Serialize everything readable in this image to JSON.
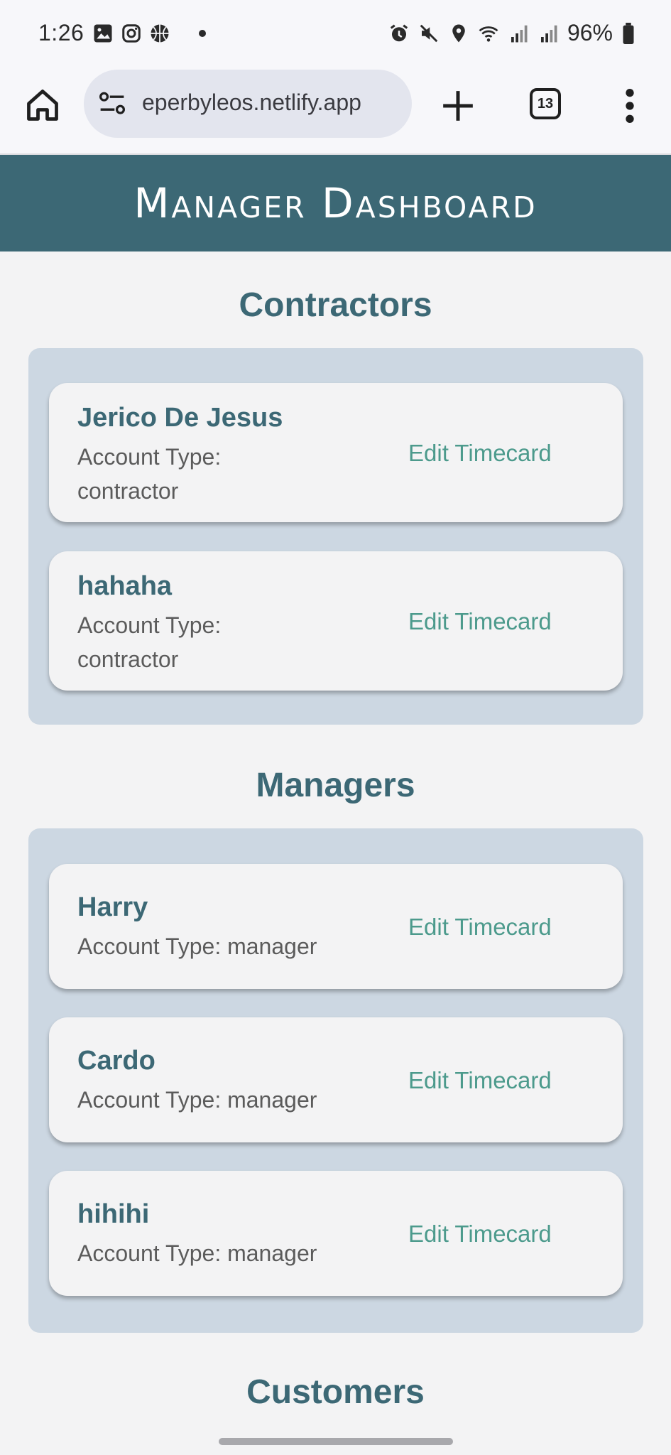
{
  "status_bar": {
    "time": "1:26",
    "battery": "96%"
  },
  "browser": {
    "url": "eperbyleos.netlify.app",
    "tab_count": "13"
  },
  "app": {
    "title": "Manager Dashboard"
  },
  "sections": {
    "contractors": {
      "title": "Contractors",
      "items": [
        {
          "name": "Jerico De Jesus",
          "account_type_line1": "Account Type:",
          "account_type_line2": "contractor",
          "action": "Edit Timecard"
        },
        {
          "name": "hahaha",
          "account_type_line1": "Account Type:",
          "account_type_line2": "contractor",
          "action": "Edit Timecard"
        }
      ]
    },
    "managers": {
      "title": "Managers",
      "items": [
        {
          "name": "Harry",
          "account_type": "Account Type: manager",
          "action": "Edit Timecard"
        },
        {
          "name": "Cardo",
          "account_type": "Account Type: manager",
          "action": "Edit Timecard"
        },
        {
          "name": "hihihi",
          "account_type": "Account Type: manager",
          "action": "Edit Timecard"
        }
      ]
    },
    "customers": {
      "title": "Customers"
    }
  },
  "colors": {
    "header_bg": "#3c6875",
    "panel_bg": "#ccd7e2",
    "link": "#4c9a8c"
  }
}
